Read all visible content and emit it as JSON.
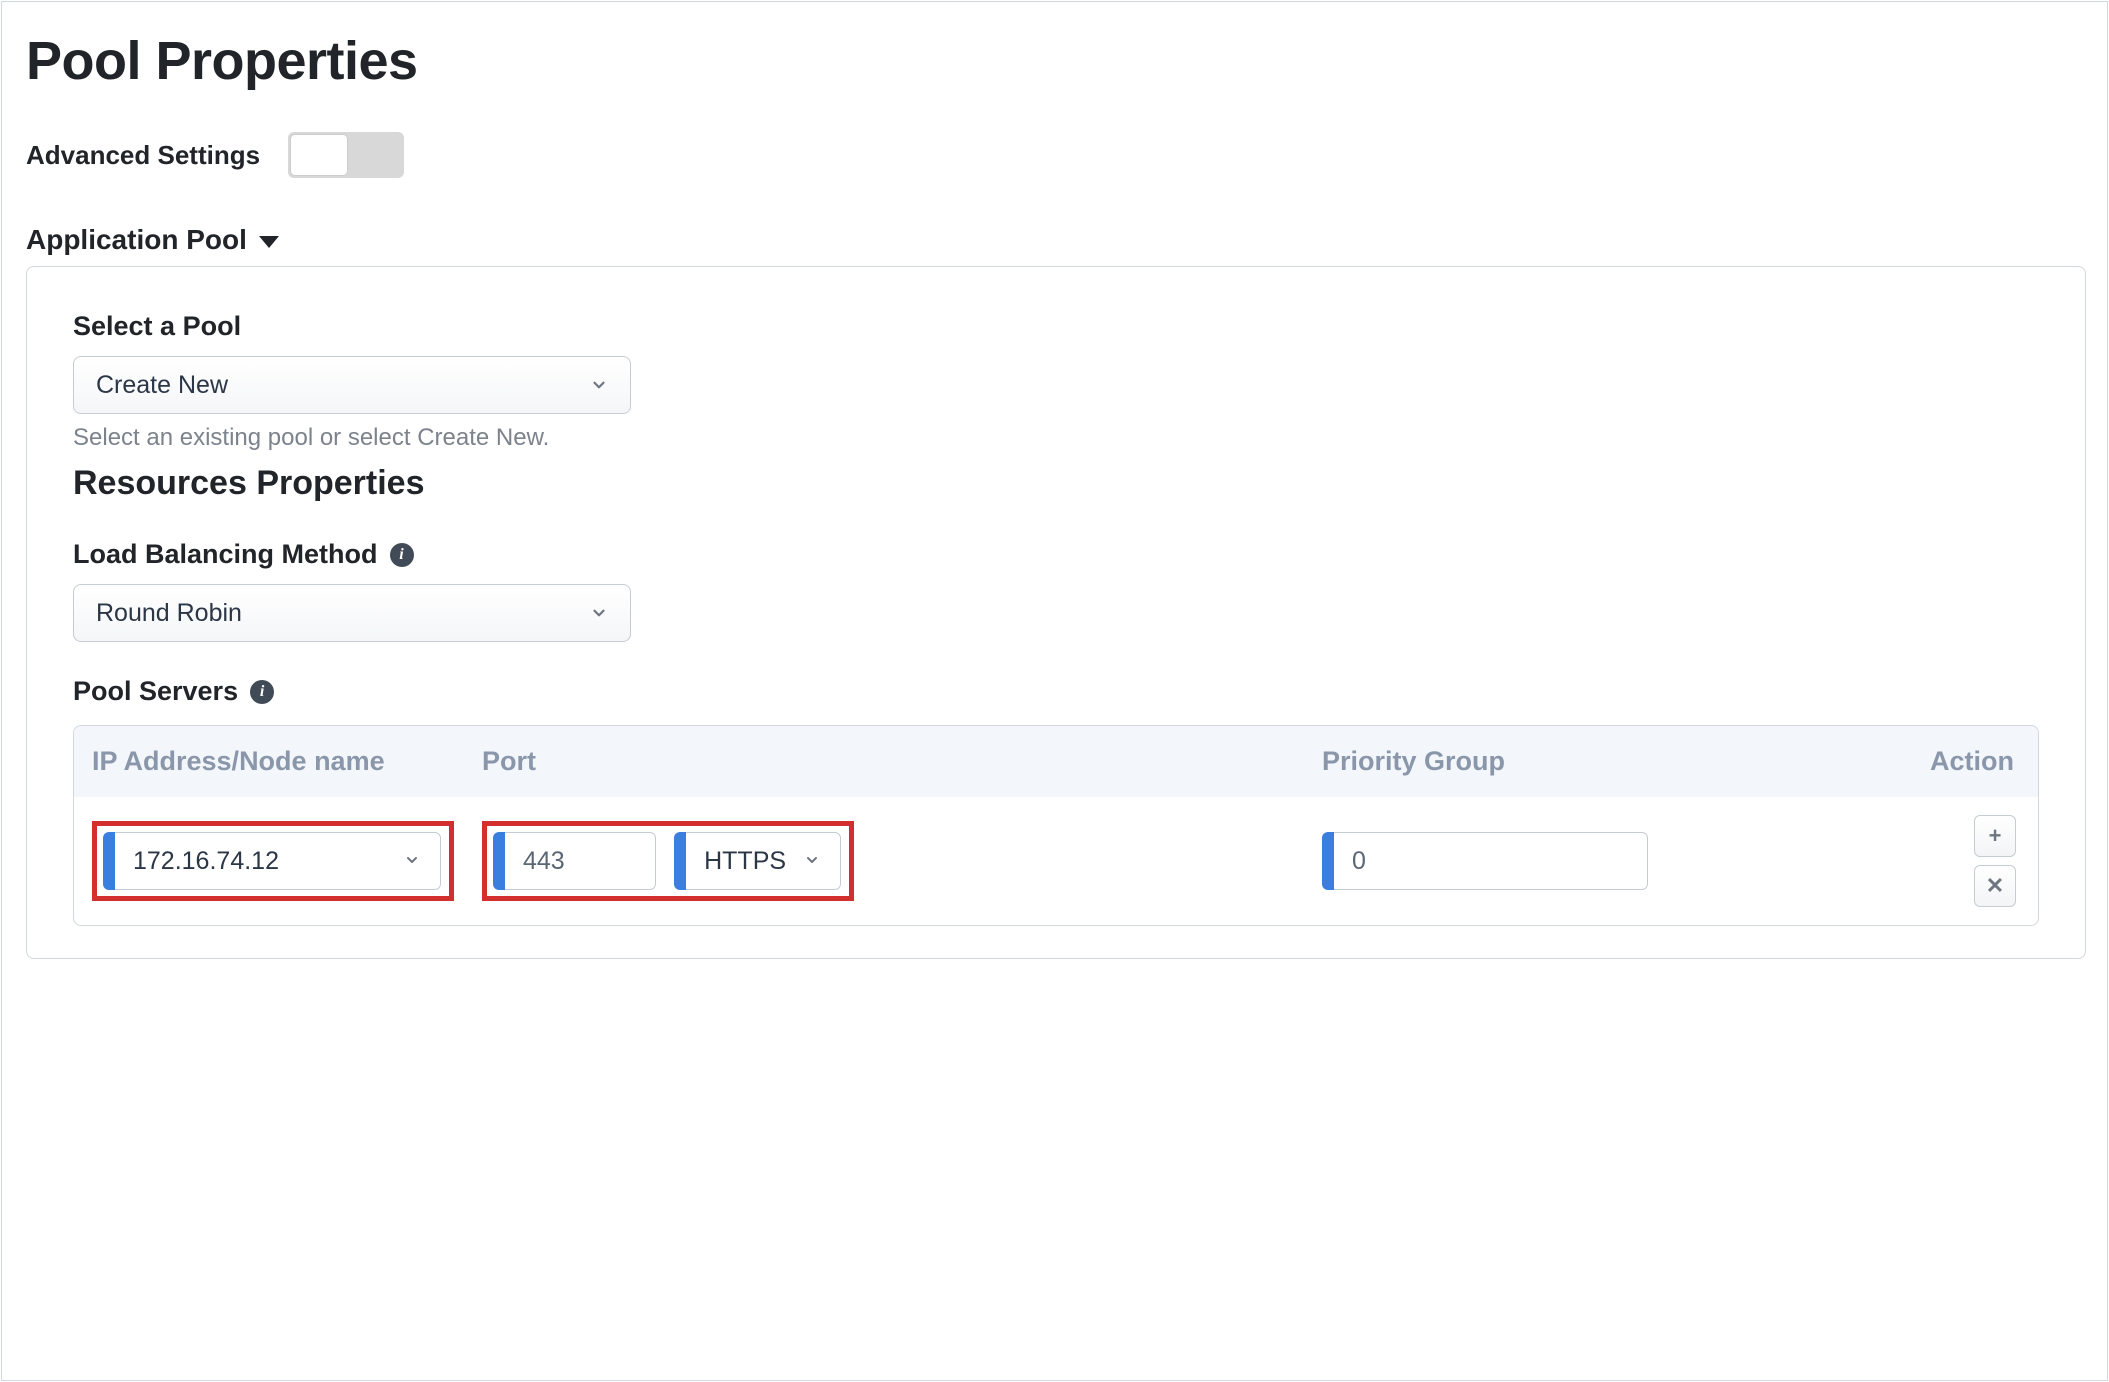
{
  "page": {
    "title": "Pool Properties",
    "advanced_settings_label": "Advanced Settings",
    "advanced_settings_on": false
  },
  "section": {
    "application_pool": {
      "header": "Application Pool",
      "select_pool_label": "Select a Pool",
      "select_pool_value": "Create New",
      "select_pool_help": "Select an existing pool or select Create New.",
      "resources_title": "Resources Properties",
      "lb_label": "Load Balancing Method",
      "lb_value": "Round Robin",
      "pool_servers_label": "Pool Servers",
      "table": {
        "headers": {
          "ip": "IP Address/Node name",
          "port": "Port",
          "priority": "Priority Group",
          "action": "Action"
        },
        "rows": [
          {
            "ip": "172.16.74.12",
            "port": "443",
            "protocol": "HTTPS",
            "priority": "0"
          }
        ]
      }
    }
  },
  "icons": {
    "plus": "+",
    "close": "✕"
  }
}
